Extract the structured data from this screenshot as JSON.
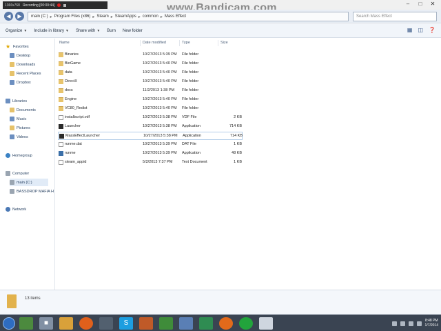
{
  "recorder": {
    "resolution": "1366x768",
    "status": "Recording [00:00:44]",
    "watermark": "www.Bandicam.com"
  },
  "address": {
    "crumbs": [
      "main (C:)",
      "Program Files (x86)",
      "Steam",
      "SteamApps",
      "common",
      "Mass Effect"
    ],
    "search_placeholder": "Search Mass Effect"
  },
  "toolbar": {
    "organize": "Organize",
    "include": "Include in library",
    "share": "Share with",
    "burn": "Burn",
    "new_folder": "New folder"
  },
  "nav": {
    "favorites": "Favorites",
    "desktop": "Desktop",
    "downloads": "Downloads",
    "recent": "Recent Places",
    "dropbox": "Dropbox",
    "libraries": "Libraries",
    "documents": "Documents",
    "music": "Music",
    "pictures": "Pictures",
    "videos": "Videos",
    "homegroup": "Homegroup",
    "computer": "Computer",
    "main_c": "main (C:)",
    "bassdrop": "BASSDROP MAFIA H",
    "network": "Network"
  },
  "columns": {
    "name": "Name",
    "date": "Date modified",
    "type": "Type",
    "size": "Size"
  },
  "files": [
    {
      "name": "Binaries",
      "date": "10/27/2013 5:39 PM",
      "type": "File folder",
      "size": "",
      "icon": "folder"
    },
    {
      "name": "BioGame",
      "date": "10/27/2013 5:40 PM",
      "type": "File folder",
      "size": "",
      "icon": "folder"
    },
    {
      "name": "data",
      "date": "10/27/2013 5:40 PM",
      "type": "File folder",
      "size": "",
      "icon": "folder"
    },
    {
      "name": "DirectX",
      "date": "10/27/2013 5:40 PM",
      "type": "File folder",
      "size": "",
      "icon": "folder"
    },
    {
      "name": "docs",
      "date": "11/2/2013 1:38 PM",
      "type": "File folder",
      "size": "",
      "icon": "folder"
    },
    {
      "name": "Engine",
      "date": "10/27/2013 5:40 PM",
      "type": "File folder",
      "size": "",
      "icon": "folder"
    },
    {
      "name": "VC80_Redist",
      "date": "10/27/2013 5:40 PM",
      "type": "File folder",
      "size": "",
      "icon": "folder"
    },
    {
      "name": "installscript.vdf",
      "date": "10/27/2013 5:38 PM",
      "type": "VDF File",
      "size": "2 KB",
      "icon": "doc"
    },
    {
      "name": "Launcher",
      "date": "10/27/2013 5:38 PM",
      "type": "Application",
      "size": "714 KB",
      "icon": "app"
    },
    {
      "name": "MassEffectLauncher",
      "date": "10/27/2013 5:38 PM",
      "type": "Application",
      "size": "714 KB",
      "icon": "app"
    },
    {
      "name": "runme.dat",
      "date": "10/27/2013 5:39 PM",
      "type": "DAT File",
      "size": "1 KB",
      "icon": "doc"
    },
    {
      "name": "runme",
      "date": "10/27/2013 5:39 PM",
      "type": "Application",
      "size": "48 KB",
      "icon": "app2"
    },
    {
      "name": "steam_appid",
      "date": "5/2/2013 7:37 PM",
      "type": "Text Document",
      "size": "1 KB",
      "icon": "doc"
    }
  ],
  "status": {
    "item_count": "13 items"
  },
  "clock": {
    "time": "8:48 PM",
    "date": "1/7/2014"
  },
  "taskbar_apps": [
    "explorer",
    "chrome",
    "explorer",
    "media-player",
    "firefox",
    "steam",
    "skype",
    "app",
    "app",
    "app",
    "app",
    "origin",
    "app",
    "app"
  ]
}
